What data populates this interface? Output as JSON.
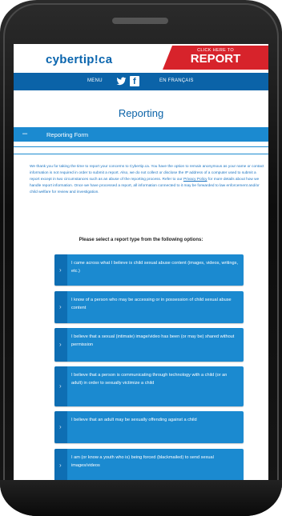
{
  "header": {
    "logo_text": "cybertip!ca",
    "cta_small": "CLICK HERE TO",
    "cta_big": "REPORT"
  },
  "nav": {
    "menu_label": "MENU",
    "twitter_icon": "twitter-icon",
    "facebook_icon": "facebook-icon",
    "language_label": "EN FRANÇAIS"
  },
  "page": {
    "title": "Reporting",
    "section_label": "Reporting Form",
    "intro_text": "We thank you for taking the time to report your concerns to Cybertip.ca. You have the option to remain anonymous as your name or contact information is not required in order to submit a report. Also, we do not collect or disclose the IP address of a computer used to submit a report except in two circumstances such as an abuse of the reporting process. Refer to our",
    "intro_link": "Privacy Policy",
    "intro_text_end": "for more details about how we handle report information. Once we have processed a report, all information connected to it may be forwarded to law enforcement and/or child welfare for review and investigation.",
    "select_prompt": "Please select a report type from the following options:"
  },
  "options": [
    {
      "label": "I came across what I believe is child sexual abuse content (images, videos, writings, etc.)"
    },
    {
      "label": "I know of a person who may be accessing or in possession of child sexual abuse content"
    },
    {
      "label": "I believe that a sexual (intimate) image/video has been (or may be) shared without permission"
    },
    {
      "label": "I believe that a person is communicating through technology with a child (or an adult) in order to sexually victimize a child"
    },
    {
      "label": "I believe that an adult may be sexually offending against a child"
    },
    {
      "label": "I am (or know a youth who is) being forced (blackmailed) to send sexual images/videos"
    }
  ],
  "colors": {
    "brand_blue": "#0b63a8",
    "option_blue": "#1b8ad0",
    "report_red": "#d7232b"
  }
}
